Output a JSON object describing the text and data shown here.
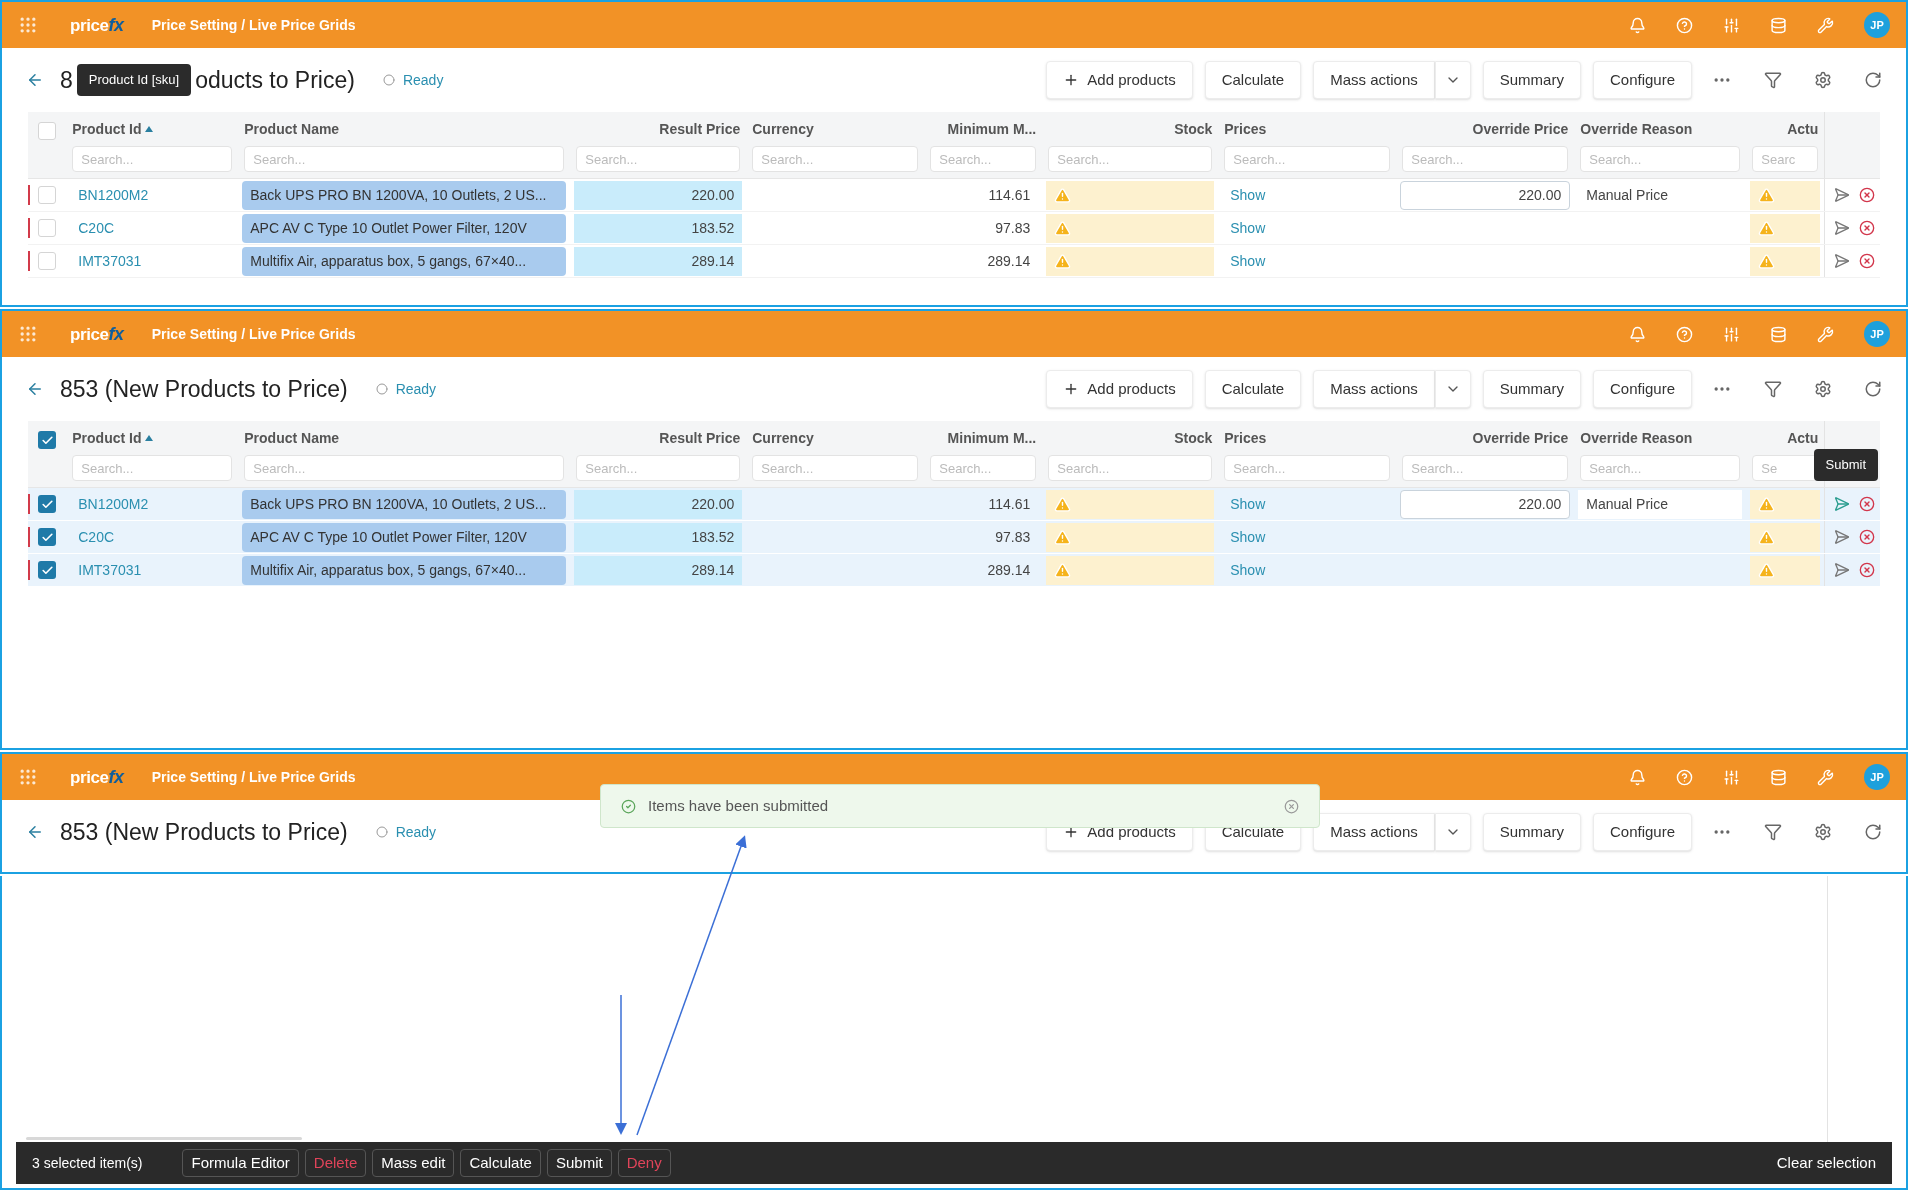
{
  "panels": [
    {
      "header": {
        "logo": {
          "text": "price",
          "accent": "fx"
        },
        "breadcrumb": "Price Setting / Live Price Grids",
        "avatar": "JP"
      },
      "title_parts": [
        "8",
        "oducts to Price)"
      ],
      "title_tooltip": "Product Id [sku]",
      "status": "Ready",
      "toolbar": {
        "add": "Add products",
        "calculate": "Calculate",
        "mass_actions": "Mass actions",
        "summary": "Summary",
        "configure": "Configure"
      },
      "grid": {
        "all_selected": false,
        "columns": [
          {
            "label": "Product Id",
            "sorted": true,
            "placeholder": "Search..."
          },
          {
            "label": "Product Name",
            "sorted": false,
            "placeholder": "Search..."
          },
          {
            "label": "Result Price",
            "sorted": false,
            "placeholder": "Search..."
          },
          {
            "label": "Currency",
            "sorted": false,
            "placeholder": "Search..."
          },
          {
            "label": "Minimum M...",
            "sorted": false,
            "placeholder": "Search..."
          },
          {
            "label": "Stock",
            "sorted": false,
            "placeholder": "Search..."
          },
          {
            "label": "Prices",
            "sorted": false,
            "placeholder": "Search..."
          },
          {
            "label": "Override Price",
            "sorted": false,
            "placeholder": "Search..."
          },
          {
            "label": "Override Reason",
            "sorted": false,
            "placeholder": "Search..."
          },
          {
            "label": "Actu",
            "sorted": false,
            "placeholder": "Searc"
          }
        ],
        "rows": [
          {
            "selected": false,
            "product_id": "BN1200M2",
            "product_name": "Back UPS PRO BN 1200VA, 10 Outlets, 2 US...",
            "result_price": "220.00",
            "minimum": "114.61",
            "prices": "Show",
            "override_price": "220.00",
            "override_reason": "Manual Price",
            "hovered": false
          },
          {
            "selected": false,
            "product_id": "C20C",
            "product_name": "APC AV C Type 10 Outlet Power Filter, 120V",
            "result_price": "183.52",
            "minimum": "97.83",
            "prices": "Show",
            "hovered": false
          },
          {
            "selected": false,
            "product_id": "IMT37031",
            "product_name": "Multifix Air, apparatus box, 5 gangs, 67×40...",
            "result_price": "289.14",
            "minimum": "289.14",
            "prices": "Show",
            "hovered": false
          }
        ]
      }
    },
    {
      "header": {
        "logo": {
          "text": "price",
          "accent": "fx"
        },
        "breadcrumb": "Price Setting / Live Price Grids",
        "avatar": "JP"
      },
      "title": "853 (New Products to Price)",
      "status": "Ready",
      "toolbar": {
        "add": "Add products",
        "calculate": "Calculate",
        "mass_actions": "Mass actions",
        "summary": "Summary",
        "configure": "Configure"
      },
      "action_tooltip": "Submit",
      "grid": {
        "all_selected": true,
        "columns": [
          {
            "label": "Product Id",
            "sorted": true,
            "placeholder": "Search..."
          },
          {
            "label": "Product Name",
            "sorted": false,
            "placeholder": "Search..."
          },
          {
            "label": "Result Price",
            "sorted": false,
            "placeholder": "Search..."
          },
          {
            "label": "Currency",
            "sorted": false,
            "placeholder": "Search..."
          },
          {
            "label": "Minimum M...",
            "sorted": false,
            "placeholder": "Search..."
          },
          {
            "label": "Stock",
            "sorted": false,
            "placeholder": "Search..."
          },
          {
            "label": "Prices",
            "sorted": false,
            "placeholder": "Search..."
          },
          {
            "label": "Override Price",
            "sorted": false,
            "placeholder": "Search..."
          },
          {
            "label": "Override Reason",
            "sorted": false,
            "placeholder": "Search..."
          },
          {
            "label": "Actu",
            "sorted": false,
            "placeholder": "Se"
          }
        ],
        "rows": [
          {
            "selected": true,
            "product_id": "BN1200M2",
            "product_name": "Back UPS PRO BN 1200VA, 10 Outlets, 2 US...",
            "result_price": "220.00",
            "minimum": "114.61",
            "prices": "Show",
            "override_price": "220.00",
            "override_reason": "Manual Price",
            "hovered": true
          },
          {
            "selected": true,
            "product_id": "C20C",
            "product_name": "APC AV C Type 10 Outlet Power Filter, 120V",
            "result_price": "183.52",
            "minimum": "97.83",
            "prices": "Show",
            "hovered": false
          },
          {
            "selected": true,
            "product_id": "IMT37031",
            "product_name": "Multifix Air, apparatus box, 5 gangs, 67×40...",
            "result_price": "289.14",
            "minimum": "289.14",
            "prices": "Show",
            "hovered": false
          }
        ]
      }
    },
    {
      "header": {
        "logo": {
          "text": "price",
          "accent": "fx"
        },
        "breadcrumb": "Price Setting / Live Price Grids",
        "avatar": "JP"
      },
      "title": "853 (New Products to Price)",
      "status": "Ready",
      "toolbar": {
        "add": "Add products",
        "calculate": "Calculate",
        "mass_actions": "Mass actions",
        "summary": "Summary",
        "configure": "Configure"
      },
      "toast": "Items have been submitted"
    }
  ],
  "selection_bar": {
    "count": "3 selected item(s)",
    "buttons": [
      {
        "label": "Formula Editor",
        "kind": "normal"
      },
      {
        "label": "Delete",
        "kind": "danger"
      },
      {
        "label": "Mass edit",
        "kind": "normal"
      },
      {
        "label": "Calculate",
        "kind": "normal"
      },
      {
        "label": "Submit",
        "kind": "normal"
      },
      {
        "label": "Deny",
        "kind": "danger"
      }
    ],
    "clear": "Clear selection"
  }
}
